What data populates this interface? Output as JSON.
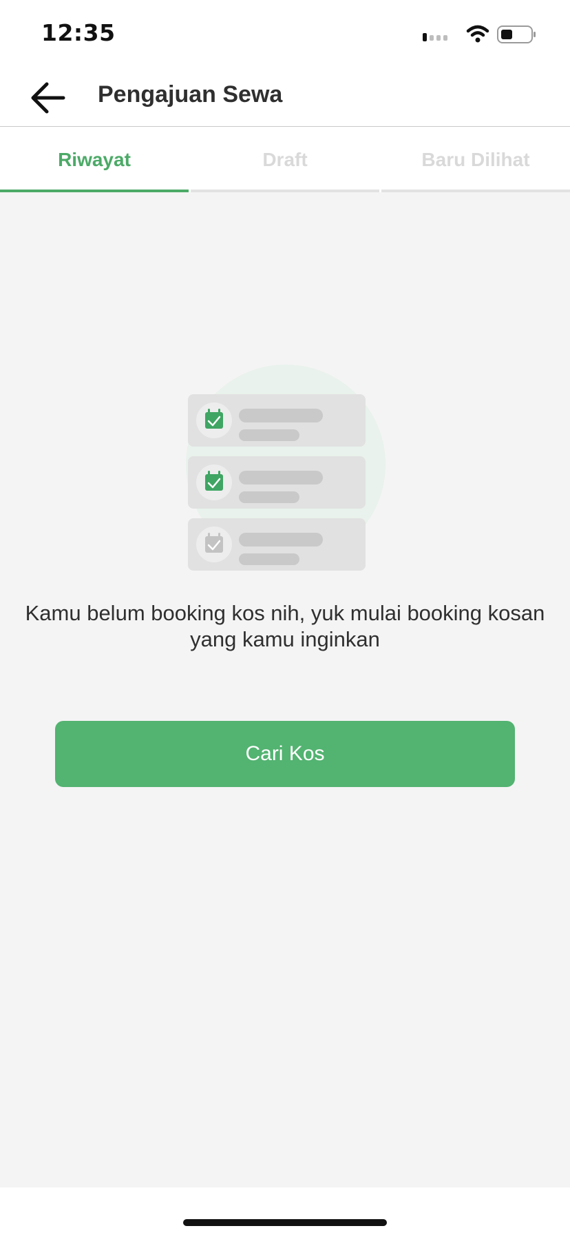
{
  "status_bar": {
    "time": "12:35",
    "icons": [
      "signal-icon",
      "wifi-icon",
      "battery-icon"
    ]
  },
  "header": {
    "title": "Pengajuan Sewa",
    "back_icon": "arrow-left-icon"
  },
  "tabs": [
    {
      "label": "Riwayat",
      "active": true
    },
    {
      "label": "Draft",
      "active": false
    },
    {
      "label": "Baru Dilihat",
      "active": false
    }
  ],
  "empty_state": {
    "message": "Kamu belum booking kos nih, yuk mulai booking kosan yang kamu inginkan",
    "illustration": "booking-list-illustration"
  },
  "primary_button": {
    "label": "Cari Kos"
  },
  "colors": {
    "accent": "#4caa67",
    "button": "#53b371",
    "background": "#f4f4f4"
  }
}
